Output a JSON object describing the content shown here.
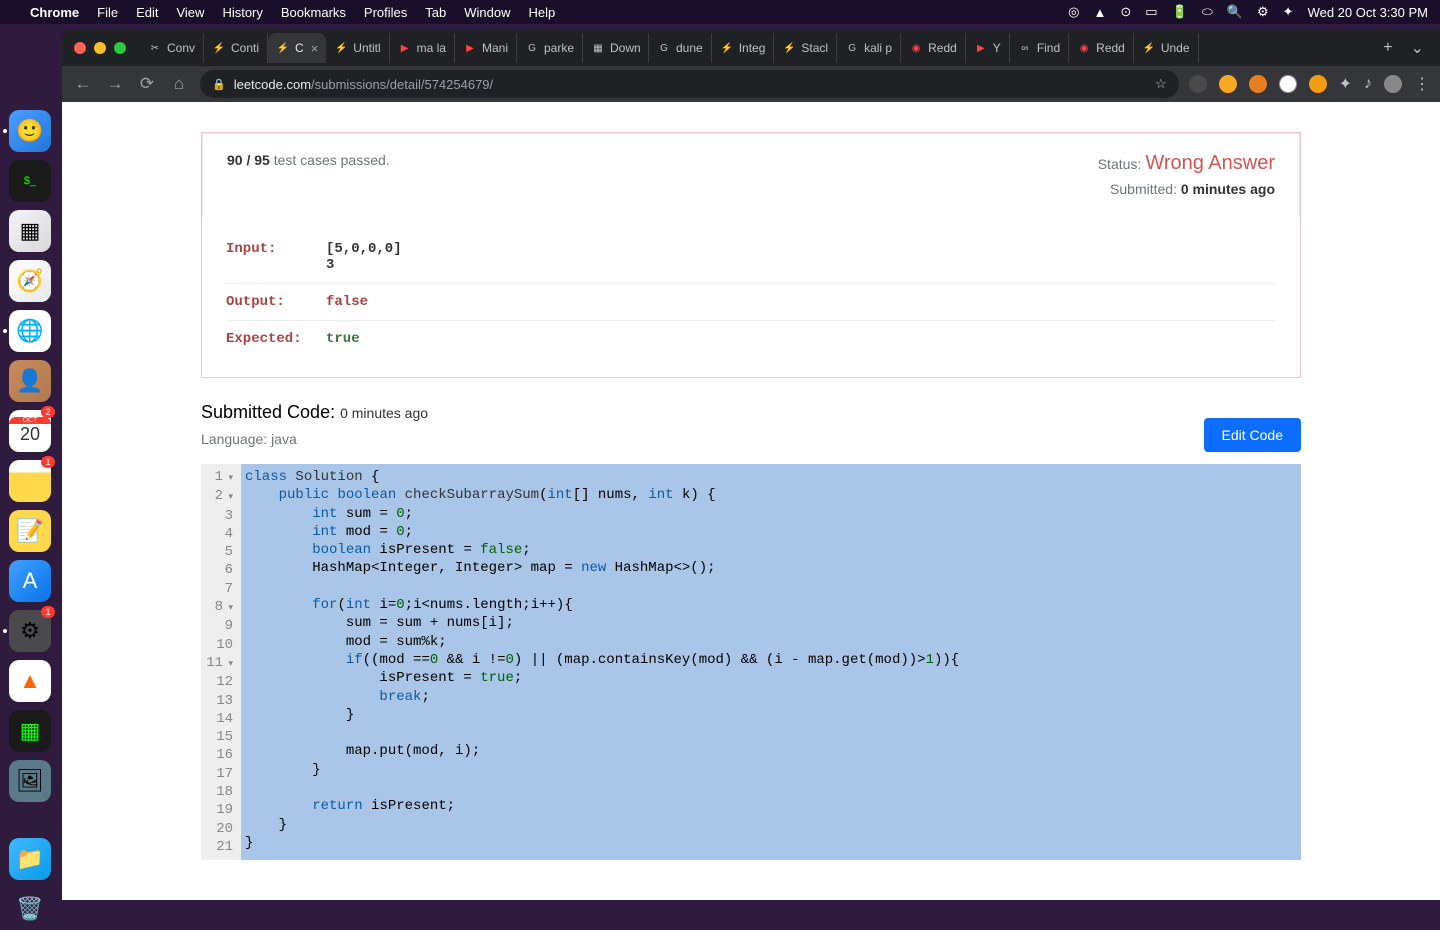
{
  "menubar": {
    "apple": "",
    "appname": "Chrome",
    "items": [
      "File",
      "Edit",
      "View",
      "History",
      "Bookmarks",
      "Profiles",
      "Tab",
      "Window",
      "Help"
    ],
    "clock": "Wed 20 Oct  3:30 PM"
  },
  "tabs": [
    {
      "favicon": "✂",
      "label": "Conv"
    },
    {
      "favicon": "⚡",
      "label": "Conti"
    },
    {
      "favicon": "⚡",
      "label": "C",
      "active": true
    },
    {
      "favicon": "⚡",
      "label": "Untitl"
    },
    {
      "favicon": "▶",
      "label": "ma la",
      "red": true
    },
    {
      "favicon": "▶",
      "label": "Mani",
      "red": true
    },
    {
      "favicon": "G",
      "label": "parke"
    },
    {
      "favicon": "▦",
      "label": "Down"
    },
    {
      "favicon": "G",
      "label": "dune"
    },
    {
      "favicon": "⚡",
      "label": "Integ"
    },
    {
      "favicon": "⚡",
      "label": "Stacl"
    },
    {
      "favicon": "G",
      "label": "kali p"
    },
    {
      "favicon": "◉",
      "label": "Redd",
      "red": true
    },
    {
      "favicon": "▶",
      "label": "Y",
      "red": true
    },
    {
      "favicon": "∞",
      "label": "Find"
    },
    {
      "favicon": "◉",
      "label": "Redd",
      "red": true
    },
    {
      "favicon": "⚡",
      "label": "Unde"
    }
  ],
  "url": {
    "domain": "leetcode.com",
    "path": "/submissions/detail/574254679/"
  },
  "dock": {
    "calendar_month": "OCT",
    "calendar_day": "20",
    "calendar_badge": "2",
    "notes_badge": "1",
    "settings_badge": "1"
  },
  "page": {
    "passed": "90",
    "total": "95",
    "passed_suffix": "test cases passed.",
    "status_label": "Status:",
    "status_value": "Wrong Answer",
    "submitted_label": "Submitted:",
    "submitted_value": "0 minutes ago",
    "input_label": "Input:",
    "input_value": "[5,0,0,0]\n3",
    "output_label": "Output:",
    "output_value": "false",
    "expected_label": "Expected:",
    "expected_value": "true",
    "code_title": "Submitted Code:",
    "code_ago": "0 minutes ago",
    "lang_label": "Language: java",
    "edit_btn": "Edit Code"
  },
  "code": {
    "line_count": 21,
    "fold_lines": [
      1,
      2,
      8,
      11
    ]
  }
}
